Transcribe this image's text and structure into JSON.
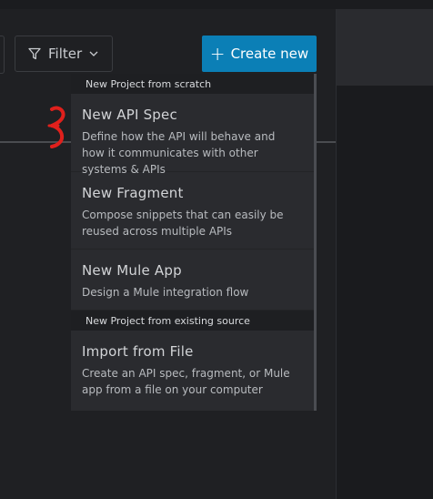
{
  "toolbar": {
    "filter_label": "Filter",
    "create_label": "Create new",
    "create_color": "#0b7fb6"
  },
  "menu": {
    "sections": [
      {
        "header": "New Project from scratch",
        "items": [
          {
            "title": "New API Spec",
            "description": "Define how the API will behave and how it communicates with other systems & APIs"
          },
          {
            "title": "New Fragment",
            "description": "Compose snippets that can easily be reused across multiple APIs"
          },
          {
            "title": "New Mule App",
            "description": "Design a Mule integration flow"
          }
        ]
      },
      {
        "header": "New Project from existing source",
        "items": [
          {
            "title": "Import from File",
            "description": "Create an API spec, fragment, or Mule app from a file on your computer"
          }
        ]
      }
    ]
  },
  "annotation": {
    "color": "#e0201c",
    "icon": "red-arrow-annotation"
  }
}
